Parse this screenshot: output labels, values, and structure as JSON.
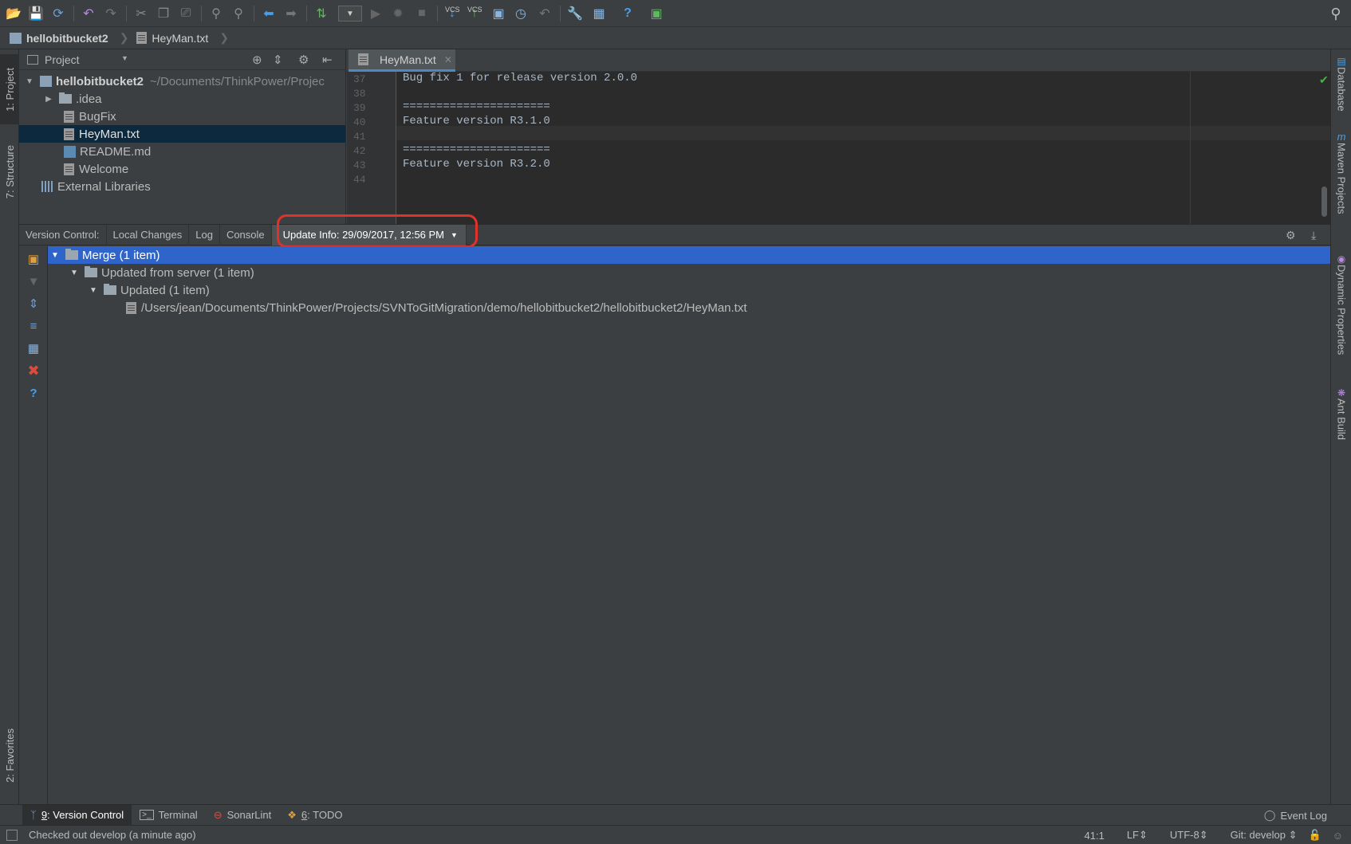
{
  "toolbar": {
    "icons": [
      "open-folder-icon",
      "save-icon",
      "sync-icon",
      "undo-icon",
      "redo-icon",
      "cut-icon",
      "copy-icon",
      "paste-icon",
      "find-icon",
      "replace-icon",
      "back-icon",
      "forward-icon",
      "build-icon",
      "run-config-dropdown-icon",
      "run-icon",
      "debug-icon",
      "stop-icon",
      "vcs-update-icon",
      "vcs-commit-icon",
      "vcs-compare-icon",
      "vcs-history-icon",
      "vcs-revert-icon",
      "settings-icon",
      "project-structure-icon",
      "help-icon",
      "remote-icon",
      "search-icon"
    ],
    "vcs_label": "VCS"
  },
  "navbar": {
    "project": "hellobitbucket2",
    "file": "HeyMan.txt"
  },
  "left_strip": {
    "project_tab": "1: Project",
    "structure_tab": "7: Structure",
    "favorites_tab": "2: Favorites"
  },
  "right_strip": {
    "tabs": [
      "Database",
      "Maven Projects",
      "Dynamic Properties",
      "Ant Build"
    ]
  },
  "project_panel": {
    "title": "Project",
    "root": {
      "name": "hellobitbucket2",
      "path": "~/Documents/ThinkPower/Projec"
    },
    "items": [
      {
        "name": ".idea",
        "type": "folder"
      },
      {
        "name": "BugFix",
        "type": "file"
      },
      {
        "name": "HeyMan.txt",
        "type": "file",
        "selected": true
      },
      {
        "name": "README.md",
        "type": "md"
      },
      {
        "name": "Welcome",
        "type": "file"
      }
    ],
    "external": "External Libraries"
  },
  "editor": {
    "tab_name": "HeyMan.txt",
    "lines": [
      {
        "num": "37",
        "text": "Bug fix 1 for release version 2.0.0"
      },
      {
        "num": "38",
        "text": ""
      },
      {
        "num": "39",
        "text": "======================"
      },
      {
        "num": "40",
        "text": "Feature version R3.1.0"
      },
      {
        "num": "41",
        "text": ""
      },
      {
        "num": "42",
        "text": "======================"
      },
      {
        "num": "43",
        "text": "Feature version R3.2.0"
      },
      {
        "num": "44",
        "text": ""
      }
    ]
  },
  "vc": {
    "label": "Version Control:",
    "tabs": [
      "Local Changes",
      "Log",
      "Console"
    ],
    "active_tab": "Update Info: 29/09/2017, 12:56 PM",
    "tree": {
      "merge": "Merge (1 item)",
      "updated_from_server": "Updated from server (1 item)",
      "updated": "Updated (1 item)",
      "file_path": "/Users/jean/Documents/ThinkPower/Projects/SVNToGitMigration/demo/hellobitbucket2/hellobitbucket2/HeyMan.txt"
    }
  },
  "bottom_bar": {
    "version_control_num": "9",
    "version_control": ": Version Control",
    "terminal": "Terminal",
    "sonarlint": "SonarLint",
    "todo_num": "6",
    "todo": ": TODO",
    "event_log": "Event Log"
  },
  "status_bar": {
    "message": "Checked out develop (a minute ago)",
    "position": "41:1",
    "line_sep": "LF",
    "encoding": "UTF-8",
    "git": "Git: develop"
  },
  "colors": {
    "selection": "#2f65ca",
    "highlight_ring": "#e0322a",
    "background": "#3c3f41",
    "editor_bg": "#2b2b2b"
  }
}
